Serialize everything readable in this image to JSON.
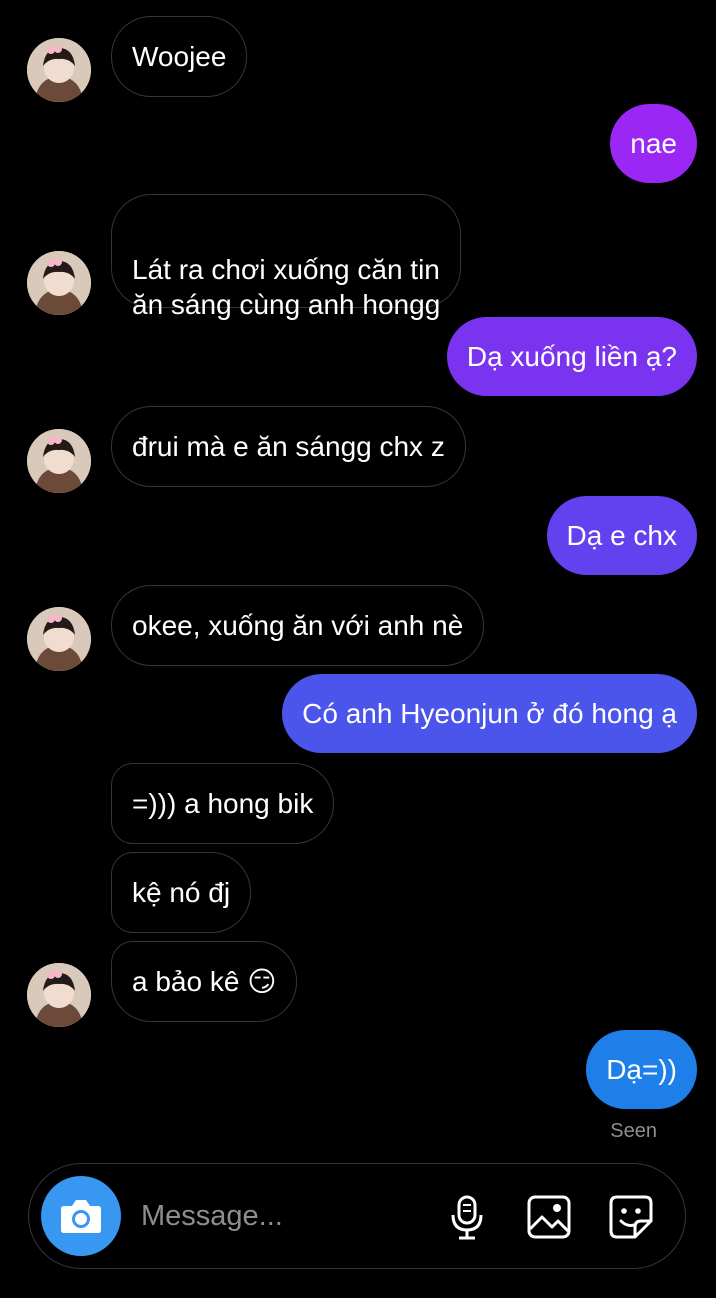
{
  "messages": [
    {
      "side": "in",
      "text": "Woojee",
      "avatar": true
    },
    {
      "side": "out",
      "text": "nae",
      "color": "#9b27f5"
    },
    {
      "side": "in",
      "text": "Lát ra chơi xuống căn tin\năn sáng cùng anh hongg",
      "avatar": true
    },
    {
      "side": "out",
      "text": "Dạ xuống liền ạ?",
      "color": "#7a34ef"
    },
    {
      "side": "in",
      "text": "đrui mà e ăn sángg chx z",
      "avatar": true
    },
    {
      "side": "out",
      "text": "Dạ e chx",
      "color": "#6242ee"
    },
    {
      "side": "in",
      "text": "okee, xuống ăn với anh nè",
      "avatar": true
    },
    {
      "side": "out",
      "text": "Có anh Hyeonjun ở đó hong ạ",
      "color": "#4b55eb"
    },
    {
      "side": "in",
      "text": "=))) a hong bik",
      "avatar": false
    },
    {
      "side": "in",
      "text": "kệ nó đj",
      "avatar": false
    },
    {
      "side": "in",
      "text": "a bảo kê 😏",
      "avatar": true
    },
    {
      "side": "out",
      "text": "Dạ=))",
      "color": "#1f7fe9"
    }
  ],
  "status": {
    "seen": "Seen"
  },
  "composer": {
    "placeholder": "Message...",
    "camera_color": "#3897f0"
  },
  "icons": [
    "camera-icon",
    "microphone-icon",
    "gallery-icon",
    "sticker-icon"
  ]
}
